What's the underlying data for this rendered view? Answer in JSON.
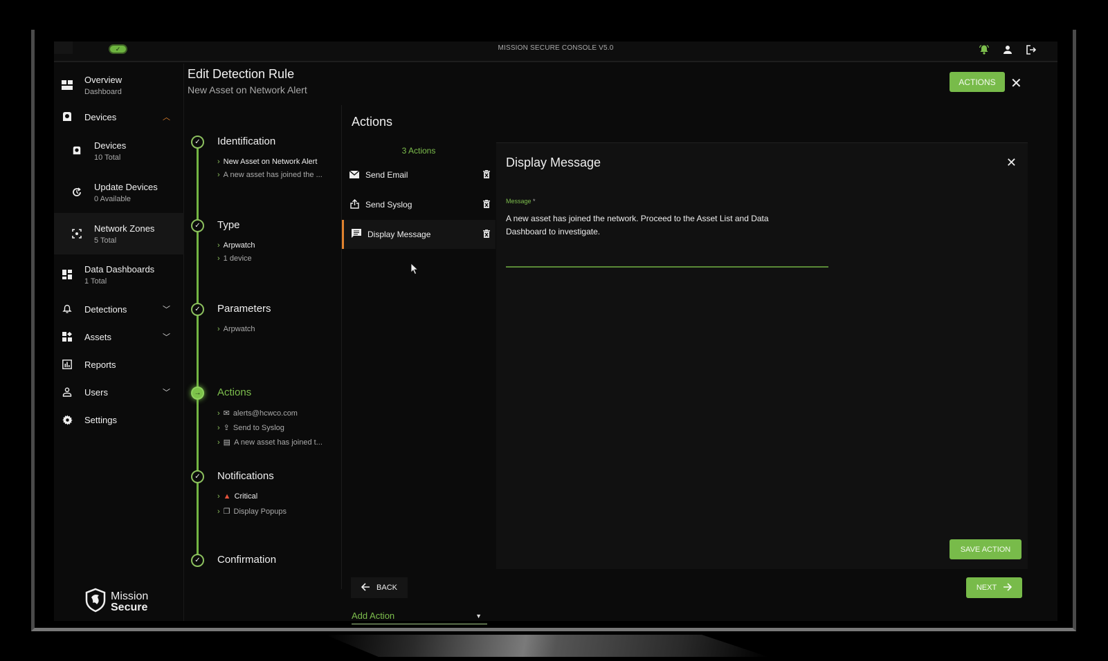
{
  "topbar": {
    "title": "MISSION SECURE CONSOLE V5.0",
    "status_icon": "check-icon",
    "icons": [
      "bell-icon",
      "user-icon",
      "logout-icon"
    ],
    "bell_color": "#7dbe4d"
  },
  "sidebar": {
    "items": [
      {
        "label": "Overview",
        "sub": "Dashboard",
        "icon": "dashboard-icon"
      },
      {
        "label": "Devices",
        "icon": "device-icon",
        "expanded": true
      },
      {
        "label": "Devices",
        "sub": "10 Total",
        "icon": "device-icon",
        "child": true
      },
      {
        "label": "Update Devices",
        "sub": "0 Available",
        "icon": "update-icon",
        "child": true
      },
      {
        "label": "Network Zones",
        "sub": "5 Total",
        "icon": "zone-icon",
        "child": true,
        "active": true
      },
      {
        "label": "Data Dashboards",
        "sub": "1 Total",
        "icon": "dashboard-icon"
      },
      {
        "label": "Detections",
        "icon": "bell-icon",
        "expandable": true
      },
      {
        "label": "Assets",
        "icon": "assets-icon",
        "expandable": true
      },
      {
        "label": "Reports",
        "icon": "reports-icon"
      },
      {
        "label": "Users",
        "icon": "user-icon",
        "expandable": true
      },
      {
        "label": "Settings",
        "icon": "gear-icon"
      }
    ],
    "logo": {
      "line1": "Mission",
      "line2": "Secure"
    }
  },
  "header": {
    "title": "Edit Detection Rule",
    "subtitle": "New Asset on Network Alert",
    "actions_button": "ACTIONS"
  },
  "stepper": {
    "steps": [
      {
        "title": "Identification",
        "status": "complete",
        "details": [
          {
            "text": "New Asset on Network Alert",
            "bright": true
          },
          {
            "text": "A new asset has joined the ..."
          }
        ]
      },
      {
        "title": "Type",
        "status": "complete",
        "details": [
          {
            "text": "Arpwatch",
            "bright": true
          },
          {
            "text": "1 device"
          }
        ]
      },
      {
        "title": "Parameters",
        "status": "complete",
        "details": [
          {
            "text": "Arpwatch"
          }
        ]
      },
      {
        "title": "Actions",
        "status": "active",
        "details": [
          {
            "text": "alerts@hcwco.com",
            "icon": "mail-icon"
          },
          {
            "text": "Send to Syslog",
            "icon": "share-icon"
          },
          {
            "text": "A new asset has joined t...",
            "icon": "message-icon"
          }
        ]
      },
      {
        "title": "Notifications",
        "status": "complete",
        "details": [
          {
            "text": "Critical",
            "icon": "alert-bell-icon",
            "bright": true
          },
          {
            "text": "Display Popups",
            "icon": "popup-icon"
          }
        ]
      },
      {
        "title": "Confirmation",
        "status": "complete",
        "details": []
      }
    ]
  },
  "actions": {
    "heading": "Actions",
    "count": "3 Actions",
    "list": [
      {
        "label": "Send Email",
        "icon": "mail-icon"
      },
      {
        "label": "Send Syslog",
        "icon": "share-icon"
      },
      {
        "label": "Display Message",
        "icon": "message-icon",
        "selected": true
      }
    ],
    "add_action_placeholder": "Add Action"
  },
  "detail": {
    "title": "Display Message",
    "message_label": "Message",
    "required_mark": "*",
    "message_value": "A new asset has joined the network. Proceed to the Asset List and Data Dashboard to investigate.",
    "save_button": "SAVE ACTION"
  },
  "footer": {
    "back_button": "BACK",
    "next_button": "NEXT"
  },
  "colors": {
    "accent_green": "#78bb4a",
    "selected_marker": "#e0822e",
    "critical_red": "#e5533c"
  }
}
